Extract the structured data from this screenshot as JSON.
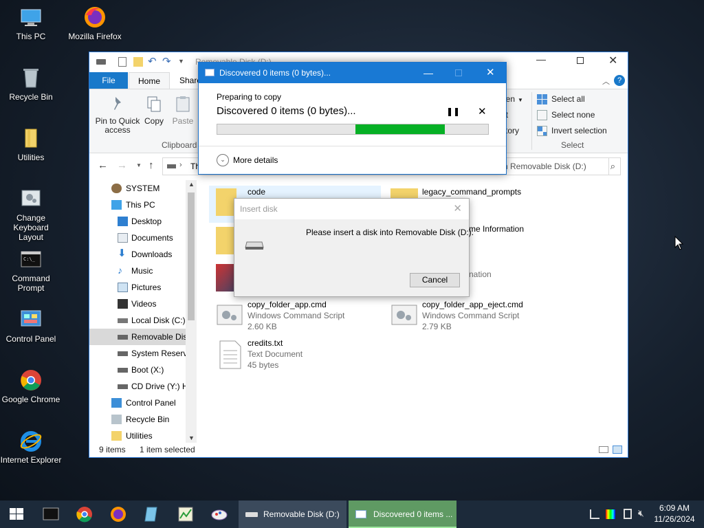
{
  "desktop": {
    "icons": [
      {
        "label": "This PC"
      },
      {
        "label": "Mozilla Firefox"
      },
      {
        "label": "Recycle Bin"
      },
      {
        "label": "Utilities"
      },
      {
        "label": "Change Keyboard Layout"
      },
      {
        "label": "Command Prompt"
      },
      {
        "label": "Control Panel"
      },
      {
        "label": "Google Chrome"
      },
      {
        "label": "Internet Explorer"
      }
    ]
  },
  "explorer": {
    "title": "Removable Disk (D:)",
    "tabs": {
      "file": "File",
      "home": "Home",
      "share": "Share"
    },
    "ribbon": {
      "pin_label": "Pin to Quick access",
      "copy_label": "Copy",
      "paste_label": "Paste",
      "clipboard_group": "Clipboard",
      "open_label": "pen",
      "edit_label": "it",
      "history_label": "story",
      "select_all": "Select all",
      "select_none": "Select none",
      "invert_selection": "Invert selection",
      "select_group": "Select"
    },
    "address_text": "Th",
    "search_placeholder": "h Removable Disk (D:)",
    "nav": [
      {
        "label": "SYSTEM"
      },
      {
        "label": "This PC"
      },
      {
        "label": "Desktop"
      },
      {
        "label": "Documents"
      },
      {
        "label": "Downloads"
      },
      {
        "label": "Music"
      },
      {
        "label": "Pictures"
      },
      {
        "label": "Videos"
      },
      {
        "label": "Local Disk (C:)"
      },
      {
        "label": "Removable Dis"
      },
      {
        "label": "System Reserve"
      },
      {
        "label": "Boot (X:)"
      },
      {
        "label": "CD Drive (Y:) H"
      },
      {
        "label": "Control Panel"
      },
      {
        "label": "Recycle Bin"
      },
      {
        "label": "Utilities"
      }
    ],
    "files": {
      "code": {
        "name": "code"
      },
      "legacy": {
        "name": "legacy_command_prompts"
      },
      "info_partial": {
        "name": "me Information"
      },
      "info_partial2": {
        "name": "nation"
      },
      "copy_cmd": {
        "name": "copy_folder_app.cmd",
        "type": "Windows Command Script",
        "size": "2.60 KB"
      },
      "copy_eject": {
        "name": "copy_folder_app_eject.cmd",
        "type": "Windows Command Script",
        "size": "2.79 KB"
      },
      "credits": {
        "name": "credits.txt",
        "type": "Text Document",
        "size": "45 bytes"
      }
    },
    "status": {
      "items": "9 items",
      "selected": "1 item selected"
    }
  },
  "copy_dialog": {
    "title": "Discovered 0 items (0 bytes)...",
    "subtitle": "Preparing to copy",
    "headline": "Discovered 0 items (0 bytes)...",
    "more_details": "More details",
    "progress": {
      "start": 0.51,
      "end": 0.84
    }
  },
  "insert_dialog": {
    "title": "Insert disk",
    "message": "Please insert a disk into Removable Disk (D:).",
    "cancel": "Cancel"
  },
  "taskbar": {
    "task1": "Removable Disk (D:)",
    "task2": "Discovered 0 items ...",
    "time": "6:09 AM",
    "date": "11/26/2024"
  }
}
